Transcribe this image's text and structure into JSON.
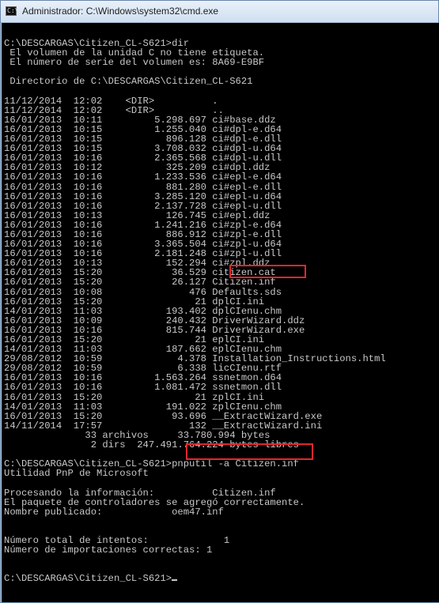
{
  "window": {
    "title": "Administrador: C:\\Windows\\system32\\cmd.exe",
    "icon_text": "C:\\"
  },
  "console": {
    "lines": [
      "",
      "C:\\DESCARGAS\\Citizen_CL-S621>dir",
      " El volumen de la unidad C no tiene etiqueta.",
      " El número de serie del volumen es: 8A69-E9BF",
      "",
      " Directorio de C:\\DESCARGAS\\Citizen_CL-S621",
      "",
      "11/12/2014  12:02    <DIR>          .",
      "11/12/2014  12:02    <DIR>          ..",
      "16/01/2013  10:11         5.298.697 ci#base.ddz",
      "16/01/2013  10:15         1.255.040 ci#dpl-e.d64",
      "16/01/2013  10:15           896.128 ci#dpl-e.dll",
      "16/01/2013  10:15         3.708.032 ci#dpl-u.d64",
      "16/01/2013  10:16         2.365.568 ci#dpl-u.dll",
      "16/01/2013  10:12           325.209 ci#dpl.ddz",
      "16/01/2013  10:16         1.233.536 ci#epl-e.d64",
      "16/01/2013  10:16           881.280 ci#epl-e.dll",
      "16/01/2013  10:16         3.285.120 ci#epl-u.d64",
      "16/01/2013  10:16         2.137.728 ci#epl-u.dll",
      "16/01/2013  10:13           126.745 ci#epl.ddz",
      "16/01/2013  10:16         1.241.216 ci#zpl-e.d64",
      "16/01/2013  10:16           886.912 ci#zpl-e.dll",
      "16/01/2013  10:16         3.365.504 ci#zpl-u.d64",
      "16/01/2013  10:16         2.181.248 ci#zpl-u.dll",
      "16/01/2013  10:13           152.294 ci#zpl.ddz",
      "16/01/2013  15:20            36.529 citizen.cat",
      "16/01/2013  15:20            26.127 Citizen.inf",
      "16/01/2013  10:08               476 Defaults.sds",
      "16/01/2013  15:20                21 dplCI.ini",
      "14/01/2013  11:03           193.402 dplCIenu.chm",
      "16/01/2013  10:09           240.432 DriverWizard.ddz",
      "16/01/2013  10:16           815.744 DriverWizard.exe",
      "16/01/2013  15:20                21 eplCI.ini",
      "14/01/2013  11:03           187.662 eplCIenu.chm",
      "29/08/2012  10:59             4.378 Installation_Instructions.html",
      "29/08/2012  10:59             6.338 licCIenu.rtf",
      "16/01/2013  10:16         1.563.264 ssnetmon.d64",
      "16/01/2013  10:16         1.081.472 ssnetmon.dll",
      "16/01/2013  15:20                21 zplCI.ini",
      "14/01/2013  11:03           191.022 zplCIenu.chm",
      "16/01/2013  15:20            93.696 __ExtractWizard.exe",
      "14/11/2014  17:57               132 __ExtractWizard.ini",
      "              33 archivos     33.780.994 bytes",
      "               2 dirs  247.491.764.224 bytes libres",
      "",
      "C:\\DESCARGAS\\Citizen_CL-S621>pnputil -a Citizen.inf",
      "Utilidad PnP de Microsoft",
      "",
      "Procesando la información:          Citizen.inf",
      "El paquete de controladores se agregó correctamente.",
      "Nombre publicado:            oem47.inf",
      "",
      "",
      "Número total de intentos:             1",
      "Número de importaciones correctas: 1",
      "",
      "",
      "C:\\DESCARGAS\\Citizen_CL-S621>"
    ]
  },
  "highlight_color": "#e3272d"
}
